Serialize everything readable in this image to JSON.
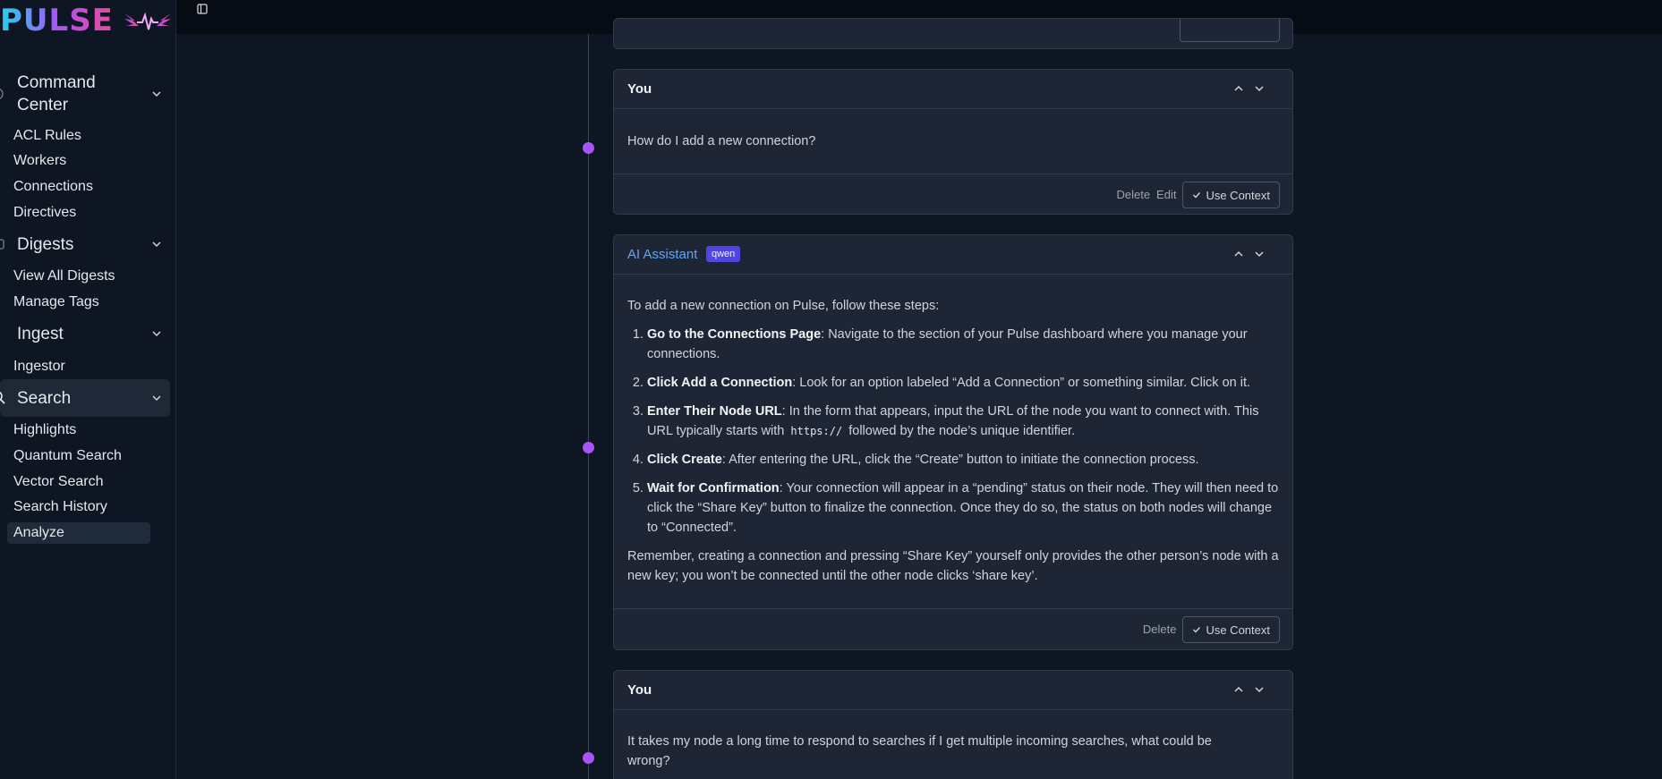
{
  "app": {
    "logo_text": "PULSE"
  },
  "sidebar": {
    "groups": [
      {
        "label_line1": "Command",
        "label_line2": "Center",
        "items": [
          "ACL Rules",
          "Workers",
          "Connections",
          "Directives"
        ]
      },
      {
        "label": "Digests",
        "items": [
          "View All Digests",
          "Manage Tags"
        ]
      },
      {
        "label": "Ingest",
        "items": [
          "Ingestor"
        ]
      },
      {
        "label": "Search",
        "items": [
          "Highlights",
          "Quantum Search",
          "Vector Search",
          "Search History",
          "Analyze"
        ]
      }
    ],
    "selected_item": "Analyze"
  },
  "messages": {
    "top_partial": {},
    "you_1": {
      "author": "You",
      "text": "How do I add a new connection?",
      "delete": "Delete",
      "edit": "Edit",
      "use_context": "Use Context"
    },
    "ai_1": {
      "author": "AI Assistant",
      "model_badge": "qwen",
      "intro": "To add a new connection on Pulse, follow these steps:",
      "steps": [
        {
          "title": "Go to the Connections Page",
          "text": ": Navigate to the section of your Pulse dashboard where you manage your connections."
        },
        {
          "title": "Click Add a Connection",
          "text": ": Look for an option labeled “Add a Connection” or something similar. Click on it."
        },
        {
          "title": "Enter Their Node URL",
          "text_a": ": In the form that appears, input the URL of the node you want to connect with. This URL typically starts with",
          "code": "https://",
          "text_b": "followed by the node’s unique identifier."
        },
        {
          "title": "Click Create",
          "text": ": After entering the URL, click the “Create” button to initiate the connection process."
        },
        {
          "title": "Wait for Confirmation",
          "text": ": Your connection will appear in a “pending” status on their node. They will then need to click the “Share Key” button to finalize the connection. Once they do so, the status on both nodes will change to “Connected”."
        }
      ],
      "outro": "Remember, creating a connection and pressing “Share Key” yourself only provides the other person’s node with a new key; you won’t be connected until the other node clicks ‘share key’.",
      "delete": "Delete",
      "use_context": "Use Context"
    },
    "you_2": {
      "author": "You",
      "text": "It takes my node a long time to respond to searches if I get multiple incoming searches, what could be wrong?"
    }
  }
}
